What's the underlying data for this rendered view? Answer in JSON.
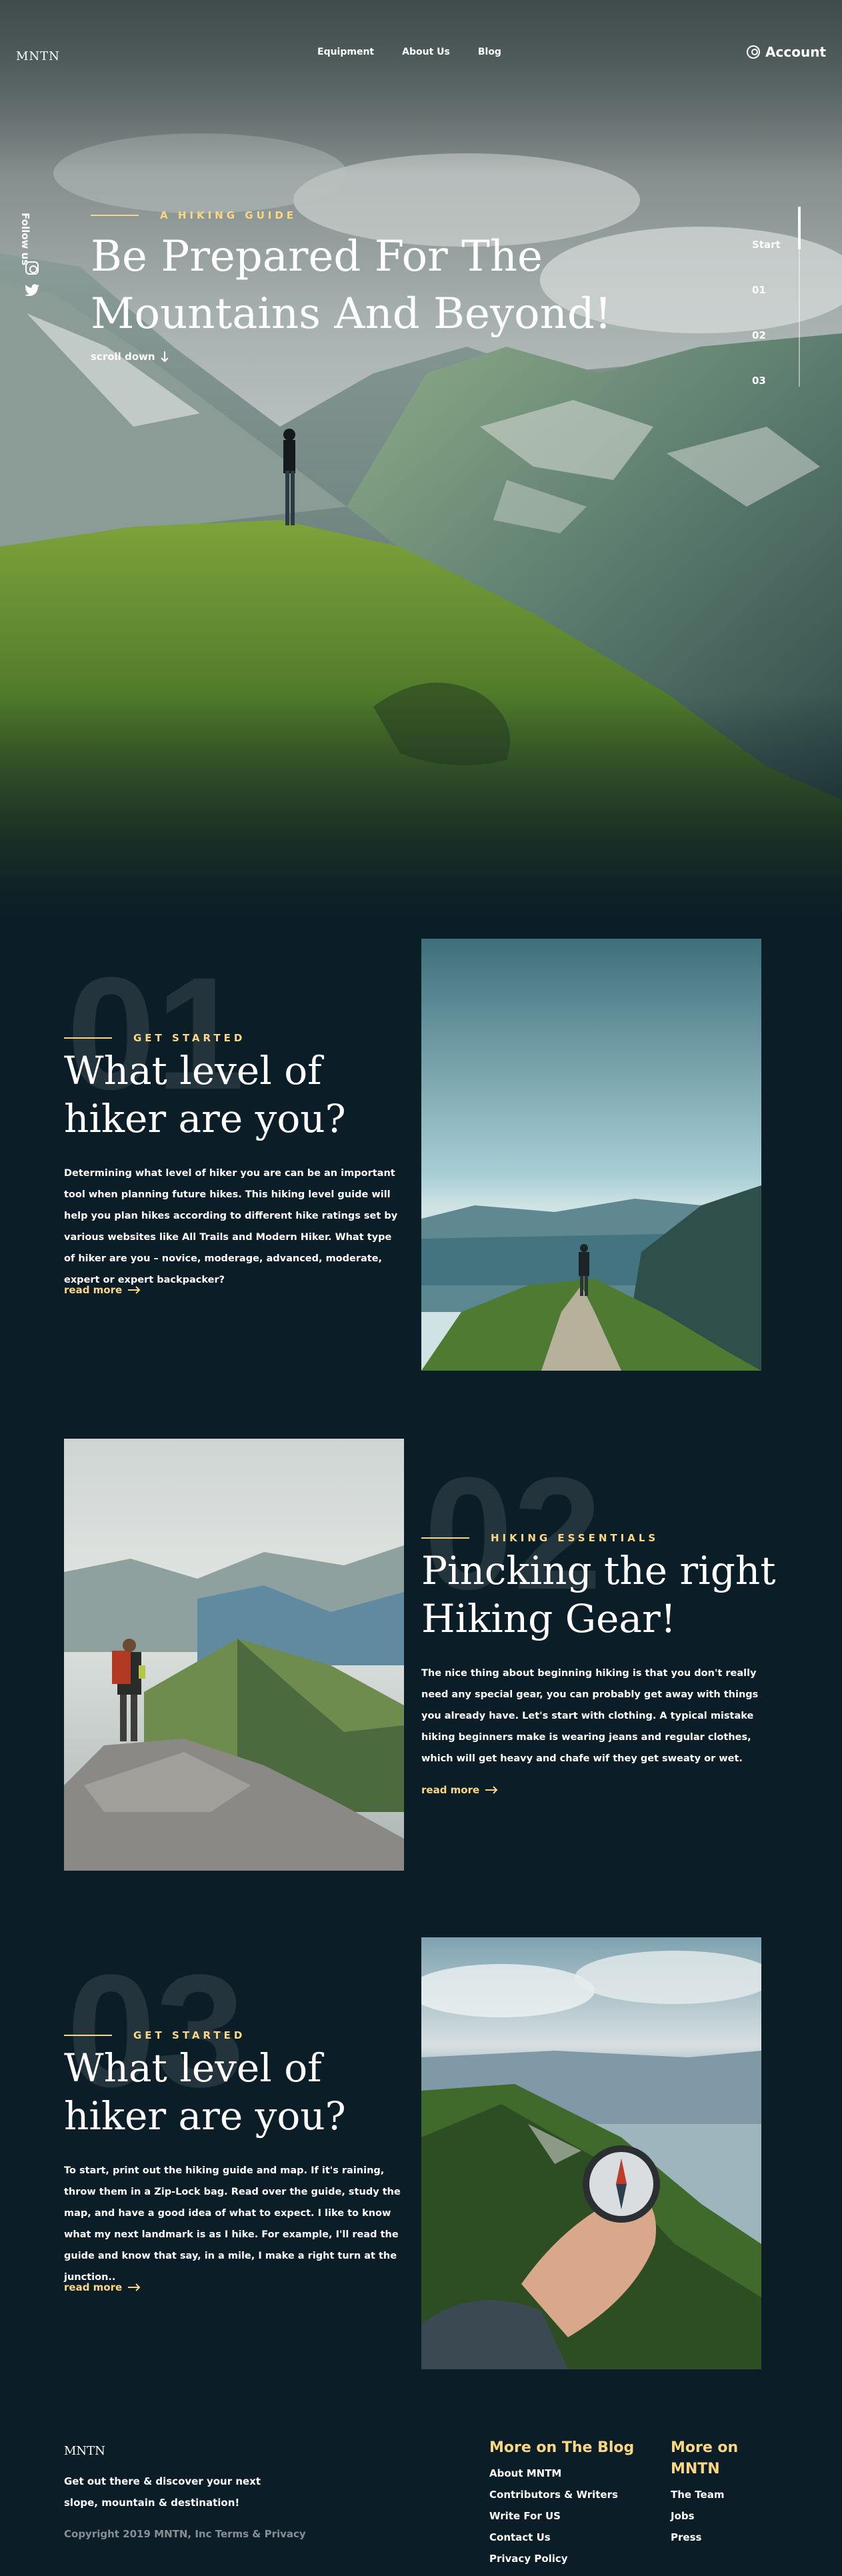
{
  "header": {
    "logo": "MNTN",
    "nav": [
      "Equipment",
      "About Us",
      "Blog"
    ],
    "account_label": "Account"
  },
  "hero": {
    "follow_label": "Follow us",
    "eyebrow": "A HIKING GUIDE",
    "title_line1": "Be Prepared For The",
    "title_line2": "Mountains And Beyond!",
    "scroll_label": "scroll down",
    "steps": [
      "Start",
      "01",
      "02",
      "03"
    ],
    "active_step": 0
  },
  "sections": [
    {
      "number": "01",
      "eyebrow": "GET STARTED",
      "title_line1": "What level of",
      "title_line2": "hiker are you?",
      "body": "Determining what level of hiker you are can be an important tool when planning future hikes. This hiking level guide will help you plan hikes according to different hike ratings set by various websites like All Trails and Modern Hiker. What type of hiker are you – novice, moderage, advanced, moderate, expert or expert backpacker?",
      "read_more": "read more"
    },
    {
      "number": "02",
      "eyebrow": "HIKING ESSENTIALS",
      "title_line1": "Pincking the right",
      "title_line2": "Hiking Gear!",
      "body": "The nice thing about beginning hiking is that you don't really need any special gear, you can probably get away with things you already have. Let's start with clothing. A typical mistake hiking beginners make is wearing jeans and regular clothes, which will get heavy and chafe wif they get sweaty or wet.",
      "read_more": "read more"
    },
    {
      "number": "03",
      "eyebrow": "GET STARTED",
      "title_line1": "What level of",
      "title_line2": "hiker are you?",
      "body": "To start, print out the hiking guide and map. If it's raining, throw them in a Zip-Lock bag. Read over the guide, study the map, and have a good idea of what to expect. I like to know what my next landmark is as I hike. For example, I'll read the guide and know that say, in a mile, I make a right turn at the junction..",
      "read_more": "read more"
    }
  ],
  "footer": {
    "logo": "MNTN",
    "tagline": "Get out there & discover your next slope, mountain & destination!",
    "copyright": "Copyright 2019 MNTN, Inc Terms & Privacy",
    "col1_title": "More on The Blog",
    "col1_links": [
      "About MNTM",
      "Contributors & Writers",
      "Write For US",
      "Contact Us",
      "Privacy Policy"
    ],
    "col2_title_line1": "More on",
    "col2_title_line2": "MNTN",
    "col2_links": [
      "The Team",
      "Jobs",
      "Press"
    ]
  },
  "colors": {
    "background": "#0b1d26",
    "accent": "#fbd784",
    "text": "#ffffff"
  }
}
